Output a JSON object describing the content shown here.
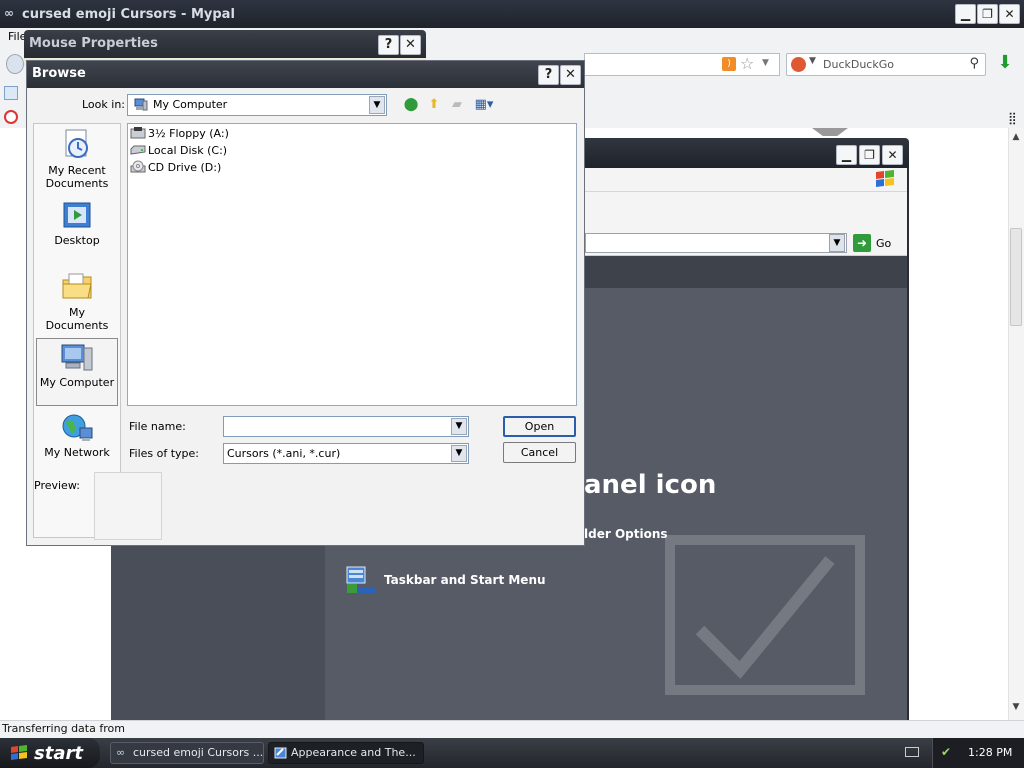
{
  "browser": {
    "title": "cursed emoji Cursors - Mypal",
    "menu_first": "File",
    "search_placeholder": "DuckDuckGo",
    "status_text": "Transferring data from",
    "buttons": {
      "minimize": "▁",
      "maximize": "❐",
      "close": "✕"
    }
  },
  "control_panel": {
    "heading": "anel icon",
    "links": [
      "lder Options",
      "Taskbar and Start Menu"
    ],
    "go_label": "Go"
  },
  "mouse_properties": {
    "title": "Mouse Properties",
    "help": "?",
    "close": "✕"
  },
  "browse": {
    "title": "Browse",
    "help": "?",
    "close": "✕",
    "look_in_label": "Look in:",
    "look_in_value": "My Computer",
    "places": [
      "My Recent Documents",
      "Desktop",
      "My Documents",
      "My Computer",
      "My Network"
    ],
    "files": [
      "3½ Floppy (A:)",
      "Local Disk (C:)",
      "CD Drive (D:)"
    ],
    "file_name_label": "File name:",
    "file_name_value": "",
    "files_of_type_label": "Files of type:",
    "files_of_type_value": "Cursors (*.ani, *.cur)",
    "open_label": "Open",
    "cancel_label": "Cancel",
    "preview_label": "Preview:"
  },
  "taskbar": {
    "start_label": "start",
    "tasks": [
      "cursed emoji Cursors ...",
      "Appearance and The..."
    ],
    "clock": "1:28 PM"
  },
  "colors": {
    "dark_titlebar": "#2e3440",
    "panel_gray": "#565b66",
    "open_button_border": "#2b5ea8",
    "taskbar": "#2c3038"
  }
}
